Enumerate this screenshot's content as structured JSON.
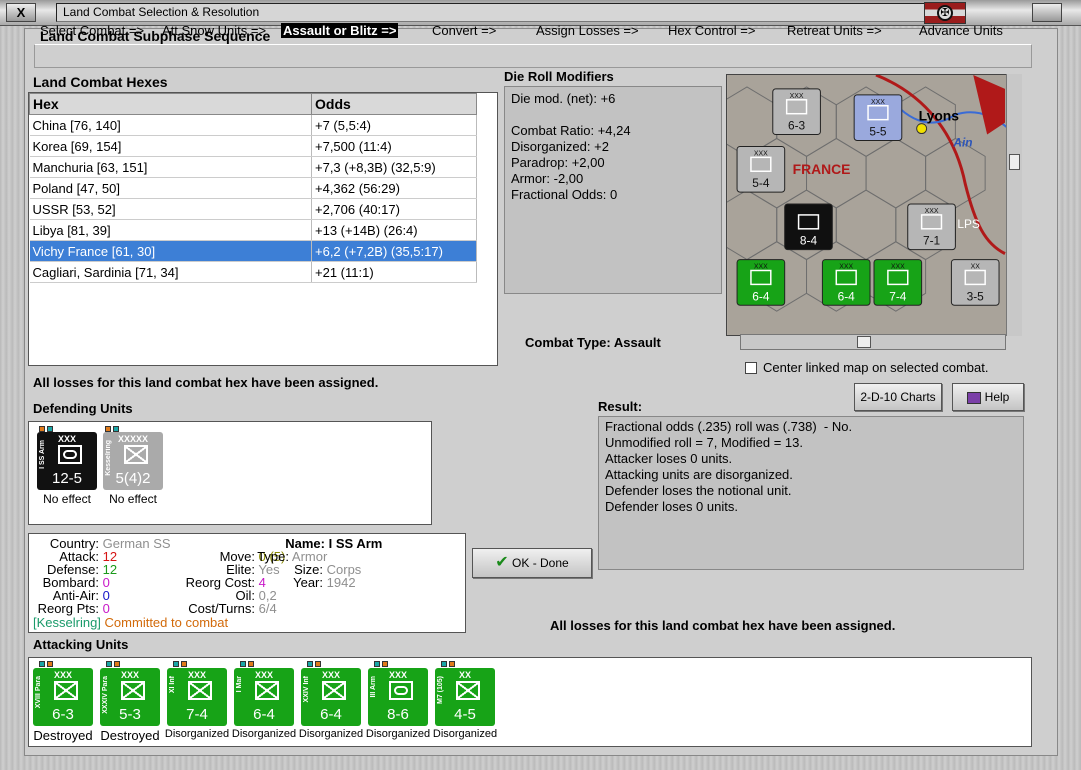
{
  "window": {
    "title": "Land Combat Selection & Resolution",
    "close_glyph": "X"
  },
  "subphase": {
    "title": "Land Combat Subphase Sequence",
    "steps": [
      "Select Combat =>",
      "Att Snow Units =>",
      "Assault or Blitz =>",
      "Convert =>",
      "Assign Losses =>",
      "Hex Control =>",
      "Retreat Units =>",
      "Advance Units"
    ],
    "active_index": 2
  },
  "hexes": {
    "title": "Land Combat Hexes",
    "headers": [
      "Hex",
      "Odds"
    ],
    "rows": [
      [
        "China [76, 140]",
        "+7 (5,5:4)"
      ],
      [
        "Korea [69, 154]",
        "+7,500 (11:4)"
      ],
      [
        "Manchuria [63, 151]",
        "+7,3 (+8,3B) (32,5:9)"
      ],
      [
        "Poland [47, 50]",
        "+4,362 (56:29)"
      ],
      [
        "USSR [53, 52]",
        "+2,706 (40:17)"
      ],
      [
        "Libya [81, 39]",
        "+13 (+14B) (26:4)"
      ],
      [
        "Vichy France [61, 30]",
        "+6,2 (+7,2B) (35,5:17)"
      ],
      [
        "Cagliari, Sardinia [71, 34]",
        "+21 (11:1)"
      ]
    ],
    "selected_row": 6
  },
  "die_roll": {
    "title": "Die Roll Modifiers",
    "lines": [
      "Die mod. (net): +6",
      "",
      "Combat Ratio: +4,24",
      "Disorganized: +2",
      "Paradrop: +2,00",
      "Armor: -2,00",
      "Fractional Odds: 0"
    ]
  },
  "combat_type": {
    "label": "Combat Type:",
    "value": "Assault"
  },
  "map": {
    "labels": [
      "Lyons",
      "FRANCE",
      "Ain",
      "LPS"
    ],
    "counters": [
      {
        "value": "6-3",
        "size": "XXX",
        "color": "#b6b6b6"
      },
      {
        "value": "5-5",
        "size": "XXX",
        "color": "#9aa9dd"
      },
      {
        "value": "5-4",
        "size": "XXX",
        "color": "#b6b6b6"
      },
      {
        "value": "8-4",
        "size": "XXX",
        "color": "#101010"
      },
      {
        "value": "7-1",
        "size": "XXX",
        "color": "#b6b6b6"
      },
      {
        "value": "6-4",
        "size": "XXX",
        "color": "#17a317"
      },
      {
        "value": "6-4",
        "size": "XXX",
        "color": "#17a317"
      },
      {
        "value": "7-4",
        "size": "XXX",
        "color": "#17a317"
      },
      {
        "value": "3-5",
        "size": "XX",
        "color": "#b6b6b6"
      }
    ]
  },
  "center_map_label": "Center linked map on selected combat.",
  "losses_msg_top": "All losses for this land combat hex have been assigned.",
  "losses_msg_bottom": "All losses for this land combat hex have been assigned.",
  "buttons": {
    "charts": "2-D-10 Charts",
    "help": "Help",
    "ok": "OK - Done"
  },
  "defending": {
    "title": "Defending Units",
    "units": [
      {
        "name": "I SS Arm",
        "size": "XXX",
        "value": "12-5",
        "status": "No effect",
        "color": "#111111",
        "symbol": "armor"
      },
      {
        "name": "Kesselring",
        "size": "XXXXX",
        "value": "5(4)2",
        "status": "No effect",
        "color": "#aaaaaa",
        "symbol": "infantry"
      }
    ]
  },
  "unit_info": {
    "country_lbl": "Country:",
    "country": "German SS",
    "attack_lbl": "Attack:",
    "attack": "12",
    "defense_lbl": "Defense:",
    "defense": "12",
    "bombard_lbl": "Bombard:",
    "bombard": "0",
    "antiair_lbl": "Anti-Air:",
    "antiair": "0",
    "reorg_lbl": "Reorg Pts:",
    "reorg": "0",
    "move_lbl": "Move:",
    "move": "0 (5)",
    "elite_lbl": "Elite:",
    "elite": "Yes",
    "reorgcost_lbl": "Reorg Cost:",
    "reorgcost": "4",
    "oil_lbl": "Oil:",
    "oil": "0,2",
    "costturns_lbl": "Cost/Turns:",
    "costturns": "6/4",
    "name_lbl": "Name:",
    "name": "I SS Arm",
    "type_lbl": "Type:",
    "type": "Armor",
    "size_lbl": "Size:",
    "size": "Corps",
    "year_lbl": "Year:",
    "year": "1942",
    "hq": "[Kesselring]",
    "committed": "Committed to combat"
  },
  "result": {
    "title": "Result:",
    "lines": [
      "Fractional odds (.235) roll was (.738)  - No.",
      "Unmodified roll = 7, Modified = 13.",
      "Attacker loses 0 units.",
      "Attacking units are disorganized.",
      "Defender loses the notional unit.",
      "Defender loses 0 units."
    ]
  },
  "attacking": {
    "title": "Attacking Units",
    "units": [
      {
        "name": "XVIII Para",
        "size": "XXX",
        "value": "6-3",
        "status": "Destroyed"
      },
      {
        "name": "XXXIV Para",
        "size": "XXX",
        "value": "5-3",
        "status": "Destroyed"
      },
      {
        "name": "XI Inf",
        "size": "XXX",
        "value": "7-4",
        "status": "Disorganized"
      },
      {
        "name": "I Mar",
        "size": "XXX",
        "value": "6-4",
        "status": "Disorganized"
      },
      {
        "name": "XXIV Inf",
        "size": "XXX",
        "value": "6-4",
        "status": "Disorganized"
      },
      {
        "name": "III Arm",
        "size": "XXX",
        "value": "8-6",
        "status": "Disorganized"
      },
      {
        "name": "M7 (105)",
        "size": "XX",
        "value": "4-5",
        "status": "Disorganized"
      }
    ],
    "green": "#17a317"
  }
}
